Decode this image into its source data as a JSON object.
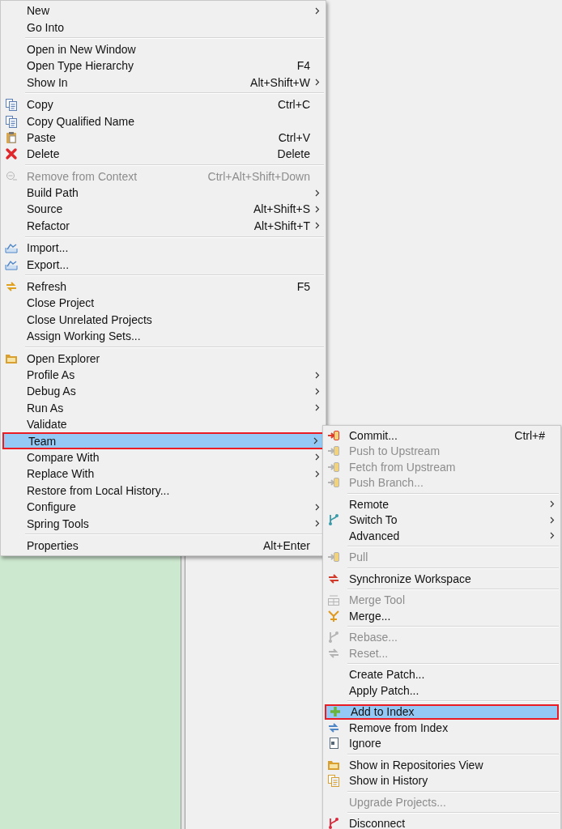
{
  "context_menu": {
    "sections": [
      {
        "items": [
          {
            "label": "New",
            "has_submenu": true,
            "disabled": false,
            "selected": false
          },
          {
            "label": "Go Into",
            "has_submenu": false,
            "disabled": false,
            "selected": false
          }
        ]
      },
      {
        "items": [
          {
            "label": "Open in New Window",
            "has_submenu": false,
            "disabled": false,
            "selected": false
          },
          {
            "label": "Open Type Hierarchy",
            "shortcut": "F4",
            "has_submenu": false,
            "disabled": false,
            "selected": false
          },
          {
            "label": "Show In",
            "shortcut": "Alt+Shift+W",
            "has_submenu": true,
            "disabled": false,
            "selected": false
          }
        ]
      },
      {
        "items": [
          {
            "label": "Copy",
            "shortcut": "Ctrl+C",
            "has_submenu": false,
            "disabled": false,
            "selected": false
          },
          {
            "label": "Copy Qualified Name",
            "has_submenu": false,
            "disabled": false,
            "selected": false
          },
          {
            "label": "Paste",
            "shortcut": "Ctrl+V",
            "has_submenu": false,
            "disabled": false,
            "selected": false
          },
          {
            "label": "Delete",
            "shortcut": "Delete",
            "has_submenu": false,
            "disabled": false,
            "selected": false
          }
        ]
      },
      {
        "items": [
          {
            "label": "Remove from Context",
            "shortcut": "Ctrl+Alt+Shift+Down",
            "has_submenu": false,
            "disabled": true,
            "selected": false
          },
          {
            "label": "Build Path",
            "has_submenu": true,
            "disabled": false,
            "selected": false
          },
          {
            "label": "Source",
            "shortcut": "Alt+Shift+S",
            "has_submenu": true,
            "disabled": false,
            "selected": false
          },
          {
            "label": "Refactor",
            "shortcut": "Alt+Shift+T",
            "has_submenu": true,
            "disabled": false,
            "selected": false
          }
        ]
      },
      {
        "items": [
          {
            "label": "Import...",
            "has_submenu": false,
            "disabled": false,
            "selected": false
          },
          {
            "label": "Export...",
            "has_submenu": false,
            "disabled": false,
            "selected": false
          }
        ]
      },
      {
        "items": [
          {
            "label": "Refresh",
            "shortcut": "F5",
            "has_submenu": false,
            "disabled": false,
            "selected": false
          },
          {
            "label": "Close Project",
            "has_submenu": false,
            "disabled": false,
            "selected": false
          },
          {
            "label": "Close Unrelated Projects",
            "has_submenu": false,
            "disabled": false,
            "selected": false
          },
          {
            "label": "Assign Working Sets...",
            "has_submenu": false,
            "disabled": false,
            "selected": false
          }
        ]
      },
      {
        "items": [
          {
            "label": "Open Explorer",
            "has_submenu": false,
            "disabled": false,
            "selected": false
          },
          {
            "label": "Profile As",
            "has_submenu": true,
            "disabled": false,
            "selected": false
          },
          {
            "label": "Debug As",
            "has_submenu": true,
            "disabled": false,
            "selected": false
          },
          {
            "label": "Run As",
            "has_submenu": true,
            "disabled": false,
            "selected": false
          },
          {
            "label": "Validate",
            "has_submenu": false,
            "disabled": false,
            "selected": false
          },
          {
            "label": "Team",
            "has_submenu": true,
            "disabled": false,
            "selected": true
          },
          {
            "label": "Compare With",
            "has_submenu": true,
            "disabled": false,
            "selected": false
          },
          {
            "label": "Replace With",
            "has_submenu": true,
            "disabled": false,
            "selected": false
          },
          {
            "label": "Restore from Local History...",
            "has_submenu": false,
            "disabled": false,
            "selected": false
          },
          {
            "label": "Configure",
            "has_submenu": true,
            "disabled": false,
            "selected": false
          },
          {
            "label": "Spring Tools",
            "has_submenu": true,
            "disabled": false,
            "selected": false
          }
        ]
      },
      {
        "items": [
          {
            "label": "Properties",
            "shortcut": "Alt+Enter",
            "has_submenu": false,
            "disabled": false,
            "selected": false
          }
        ]
      }
    ]
  },
  "team_submenu": {
    "sections": [
      {
        "items": [
          {
            "label": "Commit...",
            "shortcut": "Ctrl+#",
            "has_submenu": false,
            "disabled": false,
            "selected": false
          },
          {
            "label": "Push to Upstream",
            "has_submenu": false,
            "disabled": true,
            "selected": false
          },
          {
            "label": "Fetch from Upstream",
            "has_submenu": false,
            "disabled": true,
            "selected": false
          },
          {
            "label": "Push Branch...",
            "has_submenu": false,
            "disabled": true,
            "selected": false
          }
        ]
      },
      {
        "items": [
          {
            "label": "Remote",
            "has_submenu": true,
            "disabled": false,
            "selected": false
          },
          {
            "label": "Switch To",
            "has_submenu": true,
            "disabled": false,
            "selected": false
          },
          {
            "label": "Advanced",
            "has_submenu": true,
            "disabled": false,
            "selected": false
          }
        ]
      },
      {
        "items": [
          {
            "label": "Pull",
            "has_submenu": false,
            "disabled": true,
            "selected": false
          }
        ]
      },
      {
        "items": [
          {
            "label": "Synchronize Workspace",
            "has_submenu": false,
            "disabled": false,
            "selected": false
          }
        ]
      },
      {
        "items": [
          {
            "label": "Merge Tool",
            "has_submenu": false,
            "disabled": true,
            "selected": false
          },
          {
            "label": "Merge...",
            "has_submenu": false,
            "disabled": false,
            "selected": false
          }
        ]
      },
      {
        "items": [
          {
            "label": "Rebase...",
            "has_submenu": false,
            "disabled": true,
            "selected": false
          },
          {
            "label": "Reset...",
            "has_submenu": false,
            "disabled": true,
            "selected": false
          }
        ]
      },
      {
        "items": [
          {
            "label": "Create Patch...",
            "has_submenu": false,
            "disabled": false,
            "selected": false
          },
          {
            "label": "Apply Patch...",
            "has_submenu": false,
            "disabled": false,
            "selected": false
          }
        ]
      },
      {
        "items": [
          {
            "label": "Add to Index",
            "has_submenu": false,
            "disabled": false,
            "selected": true
          },
          {
            "label": "Remove from Index",
            "has_submenu": false,
            "disabled": false,
            "selected": false
          },
          {
            "label": "Ignore",
            "has_submenu": false,
            "disabled": false,
            "selected": false
          }
        ]
      },
      {
        "items": [
          {
            "label": "Show in Repositories View",
            "has_submenu": false,
            "disabled": false,
            "selected": false
          },
          {
            "label": "Show in History",
            "has_submenu": false,
            "disabled": false,
            "selected": false
          }
        ]
      },
      {
        "items": [
          {
            "label": "Upgrade Projects...",
            "has_submenu": false,
            "disabled": true,
            "selected": false
          }
        ]
      },
      {
        "items": [
          {
            "label": "Disconnect",
            "has_submenu": false,
            "disabled": false,
            "selected": false
          }
        ]
      }
    ]
  }
}
